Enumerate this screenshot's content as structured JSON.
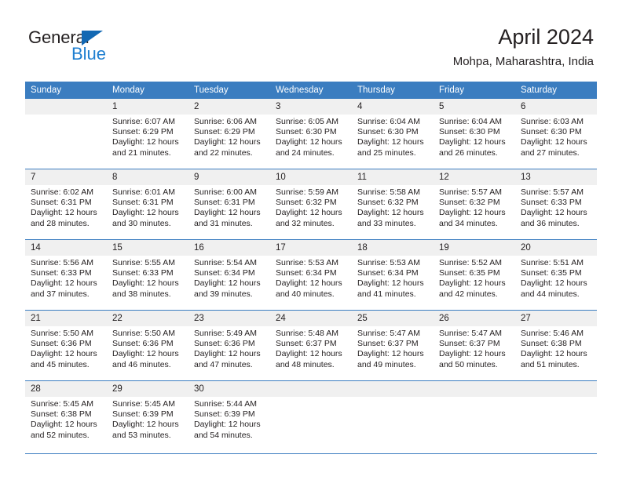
{
  "brand": {
    "name_part1": "General",
    "name_part2": "Blue",
    "triangle_color": "#1268b3",
    "blue_text_color": "#1f7fd0"
  },
  "header": {
    "title": "April 2024",
    "subtitle": "Mohpa, Maharashtra, India"
  },
  "theme": {
    "header_blue": "#3b7dc0",
    "daynum_gray": "#f0f0f0",
    "text_color": "#231f20"
  },
  "weekday_headers": [
    "Sunday",
    "Monday",
    "Tuesday",
    "Wednesday",
    "Thursday",
    "Friday",
    "Saturday"
  ],
  "labels": {
    "sunrise_prefix": "Sunrise:",
    "sunset_prefix": "Sunset:",
    "daylight_prefix": "Daylight:"
  },
  "weeks": [
    [
      {
        "day": "",
        "sunrise": "",
        "sunset": "",
        "daylight_line1": "",
        "daylight_line2": ""
      },
      {
        "day": "1",
        "sunrise": "Sunrise: 6:07 AM",
        "sunset": "Sunset: 6:29 PM",
        "daylight_line1": "Daylight: 12 hours",
        "daylight_line2": "and 21 minutes."
      },
      {
        "day": "2",
        "sunrise": "Sunrise: 6:06 AM",
        "sunset": "Sunset: 6:29 PM",
        "daylight_line1": "Daylight: 12 hours",
        "daylight_line2": "and 22 minutes."
      },
      {
        "day": "3",
        "sunrise": "Sunrise: 6:05 AM",
        "sunset": "Sunset: 6:30 PM",
        "daylight_line1": "Daylight: 12 hours",
        "daylight_line2": "and 24 minutes."
      },
      {
        "day": "4",
        "sunrise": "Sunrise: 6:04 AM",
        "sunset": "Sunset: 6:30 PM",
        "daylight_line1": "Daylight: 12 hours",
        "daylight_line2": "and 25 minutes."
      },
      {
        "day": "5",
        "sunrise": "Sunrise: 6:04 AM",
        "sunset": "Sunset: 6:30 PM",
        "daylight_line1": "Daylight: 12 hours",
        "daylight_line2": "and 26 minutes."
      },
      {
        "day": "6",
        "sunrise": "Sunrise: 6:03 AM",
        "sunset": "Sunset: 6:30 PM",
        "daylight_line1": "Daylight: 12 hours",
        "daylight_line2": "and 27 minutes."
      }
    ],
    [
      {
        "day": "7",
        "sunrise": "Sunrise: 6:02 AM",
        "sunset": "Sunset: 6:31 PM",
        "daylight_line1": "Daylight: 12 hours",
        "daylight_line2": "and 28 minutes."
      },
      {
        "day": "8",
        "sunrise": "Sunrise: 6:01 AM",
        "sunset": "Sunset: 6:31 PM",
        "daylight_line1": "Daylight: 12 hours",
        "daylight_line2": "and 30 minutes."
      },
      {
        "day": "9",
        "sunrise": "Sunrise: 6:00 AM",
        "sunset": "Sunset: 6:31 PM",
        "daylight_line1": "Daylight: 12 hours",
        "daylight_line2": "and 31 minutes."
      },
      {
        "day": "10",
        "sunrise": "Sunrise: 5:59 AM",
        "sunset": "Sunset: 6:32 PM",
        "daylight_line1": "Daylight: 12 hours",
        "daylight_line2": "and 32 minutes."
      },
      {
        "day": "11",
        "sunrise": "Sunrise: 5:58 AM",
        "sunset": "Sunset: 6:32 PM",
        "daylight_line1": "Daylight: 12 hours",
        "daylight_line2": "and 33 minutes."
      },
      {
        "day": "12",
        "sunrise": "Sunrise: 5:57 AM",
        "sunset": "Sunset: 6:32 PM",
        "daylight_line1": "Daylight: 12 hours",
        "daylight_line2": "and 34 minutes."
      },
      {
        "day": "13",
        "sunrise": "Sunrise: 5:57 AM",
        "sunset": "Sunset: 6:33 PM",
        "daylight_line1": "Daylight: 12 hours",
        "daylight_line2": "and 36 minutes."
      }
    ],
    [
      {
        "day": "14",
        "sunrise": "Sunrise: 5:56 AM",
        "sunset": "Sunset: 6:33 PM",
        "daylight_line1": "Daylight: 12 hours",
        "daylight_line2": "and 37 minutes."
      },
      {
        "day": "15",
        "sunrise": "Sunrise: 5:55 AM",
        "sunset": "Sunset: 6:33 PM",
        "daylight_line1": "Daylight: 12 hours",
        "daylight_line2": "and 38 minutes."
      },
      {
        "day": "16",
        "sunrise": "Sunrise: 5:54 AM",
        "sunset": "Sunset: 6:34 PM",
        "daylight_line1": "Daylight: 12 hours",
        "daylight_line2": "and 39 minutes."
      },
      {
        "day": "17",
        "sunrise": "Sunrise: 5:53 AM",
        "sunset": "Sunset: 6:34 PM",
        "daylight_line1": "Daylight: 12 hours",
        "daylight_line2": "and 40 minutes."
      },
      {
        "day": "18",
        "sunrise": "Sunrise: 5:53 AM",
        "sunset": "Sunset: 6:34 PM",
        "daylight_line1": "Daylight: 12 hours",
        "daylight_line2": "and 41 minutes."
      },
      {
        "day": "19",
        "sunrise": "Sunrise: 5:52 AM",
        "sunset": "Sunset: 6:35 PM",
        "daylight_line1": "Daylight: 12 hours",
        "daylight_line2": "and 42 minutes."
      },
      {
        "day": "20",
        "sunrise": "Sunrise: 5:51 AM",
        "sunset": "Sunset: 6:35 PM",
        "daylight_line1": "Daylight: 12 hours",
        "daylight_line2": "and 44 minutes."
      }
    ],
    [
      {
        "day": "21",
        "sunrise": "Sunrise: 5:50 AM",
        "sunset": "Sunset: 6:36 PM",
        "daylight_line1": "Daylight: 12 hours",
        "daylight_line2": "and 45 minutes."
      },
      {
        "day": "22",
        "sunrise": "Sunrise: 5:50 AM",
        "sunset": "Sunset: 6:36 PM",
        "daylight_line1": "Daylight: 12 hours",
        "daylight_line2": "and 46 minutes."
      },
      {
        "day": "23",
        "sunrise": "Sunrise: 5:49 AM",
        "sunset": "Sunset: 6:36 PM",
        "daylight_line1": "Daylight: 12 hours",
        "daylight_line2": "and 47 minutes."
      },
      {
        "day": "24",
        "sunrise": "Sunrise: 5:48 AM",
        "sunset": "Sunset: 6:37 PM",
        "daylight_line1": "Daylight: 12 hours",
        "daylight_line2": "and 48 minutes."
      },
      {
        "day": "25",
        "sunrise": "Sunrise: 5:47 AM",
        "sunset": "Sunset: 6:37 PM",
        "daylight_line1": "Daylight: 12 hours",
        "daylight_line2": "and 49 minutes."
      },
      {
        "day": "26",
        "sunrise": "Sunrise: 5:47 AM",
        "sunset": "Sunset: 6:37 PM",
        "daylight_line1": "Daylight: 12 hours",
        "daylight_line2": "and 50 minutes."
      },
      {
        "day": "27",
        "sunrise": "Sunrise: 5:46 AM",
        "sunset": "Sunset: 6:38 PM",
        "daylight_line1": "Daylight: 12 hours",
        "daylight_line2": "and 51 minutes."
      }
    ],
    [
      {
        "day": "28",
        "sunrise": "Sunrise: 5:45 AM",
        "sunset": "Sunset: 6:38 PM",
        "daylight_line1": "Daylight: 12 hours",
        "daylight_line2": "and 52 minutes."
      },
      {
        "day": "29",
        "sunrise": "Sunrise: 5:45 AM",
        "sunset": "Sunset: 6:39 PM",
        "daylight_line1": "Daylight: 12 hours",
        "daylight_line2": "and 53 minutes."
      },
      {
        "day": "30",
        "sunrise": "Sunrise: 5:44 AM",
        "sunset": "Sunset: 6:39 PM",
        "daylight_line1": "Daylight: 12 hours",
        "daylight_line2": "and 54 minutes."
      },
      {
        "day": "",
        "sunrise": "",
        "sunset": "",
        "daylight_line1": "",
        "daylight_line2": ""
      },
      {
        "day": "",
        "sunrise": "",
        "sunset": "",
        "daylight_line1": "",
        "daylight_line2": ""
      },
      {
        "day": "",
        "sunrise": "",
        "sunset": "",
        "daylight_line1": "",
        "daylight_line2": ""
      },
      {
        "day": "",
        "sunrise": "",
        "sunset": "",
        "daylight_line1": "",
        "daylight_line2": ""
      }
    ]
  ]
}
